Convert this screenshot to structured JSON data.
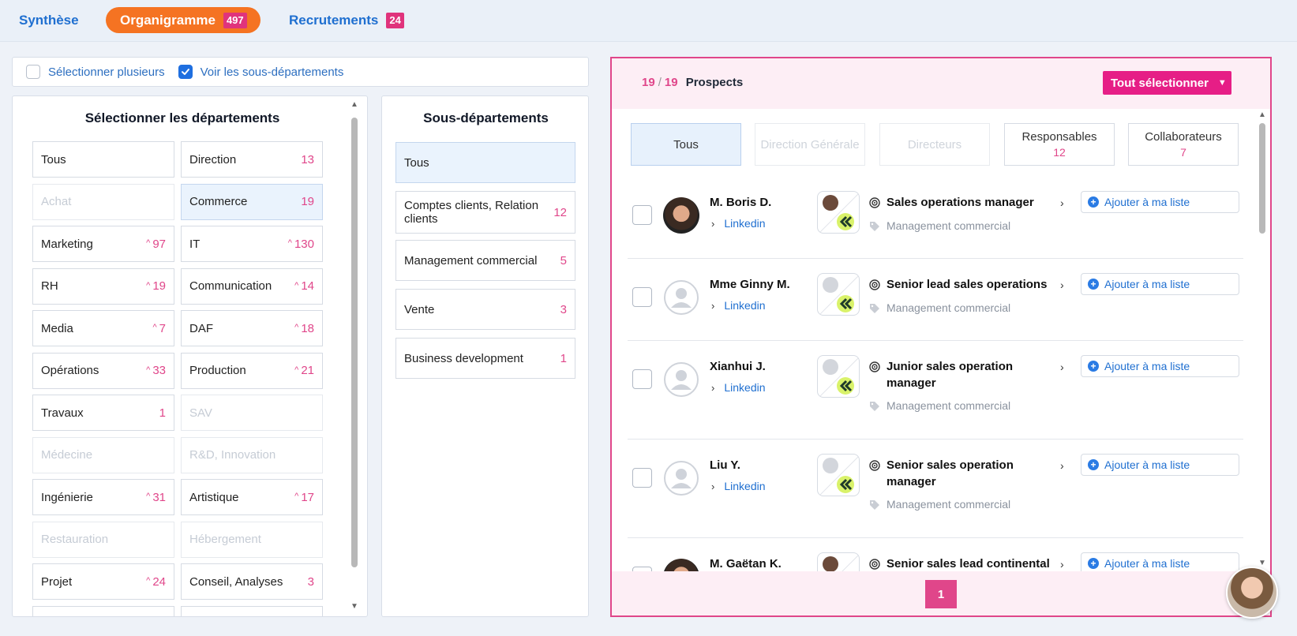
{
  "tabs": {
    "synthese": "Synthèse",
    "organigramme": "Organigramme",
    "organigramme_count": "497",
    "recrutements": "Recrutements",
    "recrutements_count": "24"
  },
  "options": {
    "select_multiple": "Sélectionner plusieurs",
    "show_subdepartments": "Voir les sous-départements"
  },
  "departments": {
    "title": "Sélectionner les départements",
    "items": [
      {
        "label": "Tous",
        "count": ""
      },
      {
        "label": "Direction",
        "count": "13"
      },
      {
        "label": "Achat",
        "count": ""
      },
      {
        "label": "Commerce",
        "count": "19"
      },
      {
        "label": "Marketing",
        "count": "97",
        "trend": "^"
      },
      {
        "label": "IT",
        "count": "130",
        "trend": "^"
      },
      {
        "label": "RH",
        "count": "19",
        "trend": "^"
      },
      {
        "label": "Communication",
        "count": "14",
        "trend": "^"
      },
      {
        "label": "Media",
        "count": "7",
        "trend": "^"
      },
      {
        "label": "DAF",
        "count": "18",
        "trend": "^"
      },
      {
        "label": "Opérations",
        "count": "33",
        "trend": "^"
      },
      {
        "label": "Production",
        "count": "21",
        "trend": "^"
      },
      {
        "label": "Travaux",
        "count": "1"
      },
      {
        "label": "SAV",
        "count": ""
      },
      {
        "label": "Médecine",
        "count": ""
      },
      {
        "label": "R&D, Innovation",
        "count": ""
      },
      {
        "label": "Ingénierie",
        "count": "31",
        "trend": "^"
      },
      {
        "label": "Artistique",
        "count": "17",
        "trend": "^"
      },
      {
        "label": "Restauration",
        "count": ""
      },
      {
        "label": "Hébergement",
        "count": ""
      },
      {
        "label": "Projet",
        "count": "24",
        "trend": "^"
      },
      {
        "label": "Conseil, Analyses",
        "count": "3"
      }
    ]
  },
  "subdepartments": {
    "title": "Sous-départements",
    "items": [
      {
        "label": "Tous",
        "count": ""
      },
      {
        "label": "Comptes clients, Relation clients",
        "count": "12"
      },
      {
        "label": "Management commercial",
        "count": "5"
      },
      {
        "label": "Vente",
        "count": "3"
      },
      {
        "label": "Business development",
        "count": "1"
      }
    ]
  },
  "prospects": {
    "shown": "19",
    "separator": "/",
    "total": "19",
    "label": "Prospects",
    "select_all": "Tout sélectionner",
    "filters": [
      {
        "label": "Tous",
        "count": ""
      },
      {
        "label": "Direction Générale",
        "count": ""
      },
      {
        "label": "Directeurs",
        "count": ""
      },
      {
        "label": "Responsables",
        "count": "12"
      },
      {
        "label": "Collaborateurs",
        "count": "7"
      }
    ],
    "link_label": "Linkedin",
    "add_label": "Ajouter à ma liste",
    "rows": [
      {
        "name": "M. Boris D.",
        "title": "Sales operations manager",
        "tag": "Management commercial"
      },
      {
        "name": "Mme Ginny M.",
        "title": "Senior lead sales operations",
        "tag": "Management commercial"
      },
      {
        "name": "Xianhui J.",
        "title": "Junior sales operation manager",
        "tag": "Management commercial"
      },
      {
        "name": "Liu Y.",
        "title": "Senior sales operation manager",
        "tag": "Management commercial"
      },
      {
        "name": "M. Gaëtan K.",
        "title": "Senior sales lead continental",
        "tag": ""
      }
    ],
    "page": "1"
  },
  "colors": {
    "accent_pink": "#e0468a",
    "accent_orange": "#f57322",
    "link_blue": "#1f6fd0"
  }
}
